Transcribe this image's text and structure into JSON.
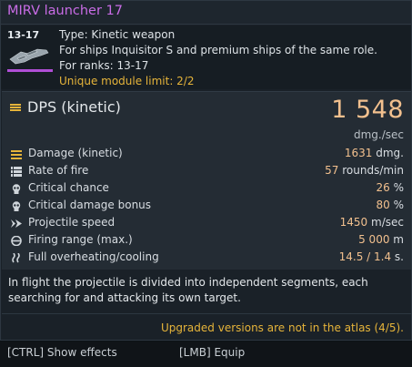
{
  "title": "MIRV launcher 17",
  "rank_range": "13-17",
  "info": {
    "type": "Type: Kinetic weapon",
    "ships": "For ships Inquisitor S and premium ships of the same role.",
    "ranks": "For ranks: 13-17",
    "limit": "Unique module limit: 2/2"
  },
  "dps": {
    "label": "DPS (kinetic)",
    "value": "1 548",
    "unit": "dmg./sec"
  },
  "stats": [
    {
      "icon": "damage-icon",
      "label": "Damage (kinetic)",
      "value": "1631",
      "unit": "dmg."
    },
    {
      "icon": "rate-of-fire-icon",
      "label": "Rate of fire",
      "value": "57",
      "unit": "rounds/min"
    },
    {
      "icon": "critical-chance-icon",
      "label": "Critical chance",
      "value": "26",
      "unit": "%"
    },
    {
      "icon": "critical-damage-icon",
      "label": "Critical damage bonus",
      "value": "80",
      "unit": "%"
    },
    {
      "icon": "projectile-speed-icon",
      "label": "Projectile speed",
      "value": "1450",
      "unit": "m/sec"
    },
    {
      "icon": "firing-range-icon",
      "label": "Firing range (max.)",
      "value": "5 000",
      "unit": "m"
    },
    {
      "icon": "overheating-icon",
      "label": "Full overheating/cooling",
      "value": "14.5 / 1.4",
      "unit": "s."
    }
  ],
  "description": "In flight the projectile is divided into independent segments, each searching for and attacking its own target.",
  "upgrade_note": "Upgraded versions are not in the atlas (4/5).",
  "footer": {
    "show_effects": "[CTRL] Show effects",
    "equip": "[LMB] Equip"
  },
  "colors": {
    "title": "#c96ce6",
    "accent_value": "#f2c08e",
    "warning": "#e6b43a",
    "rank_bar": "#b04fd6"
  }
}
